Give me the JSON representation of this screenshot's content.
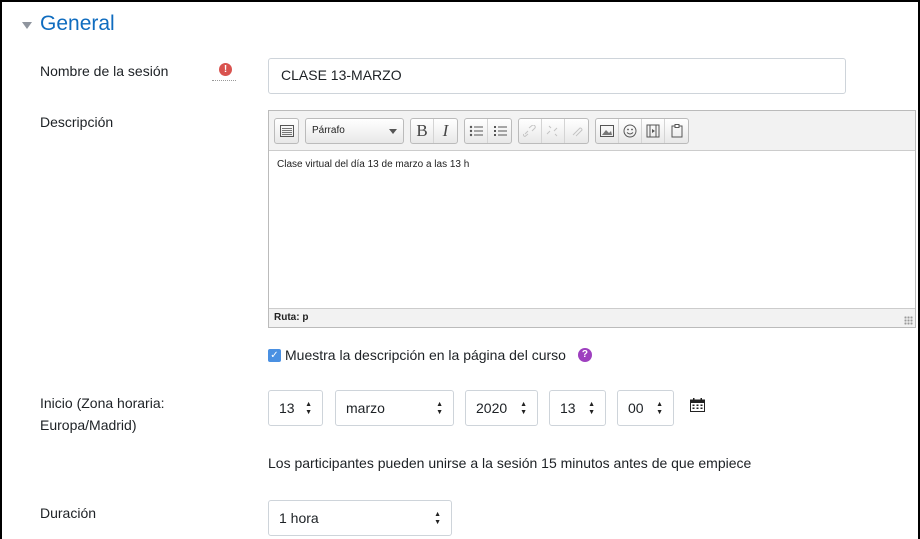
{
  "section": {
    "title": "General"
  },
  "name_field": {
    "label": "Nombre de la sesión",
    "required_icon": "exclamation-icon",
    "value": "CLASE 13-MARZO"
  },
  "description": {
    "label": "Descripción",
    "toolbar": {
      "format_select": "Párrafo",
      "buttons": [
        "expand-toolbar-icon",
        "bold-icon",
        "italic-icon",
        "bullet-list-icon",
        "numbered-list-icon",
        "link-icon",
        "unlink-icon",
        "anchor-icon",
        "image-icon",
        "emoticon-icon",
        "media-icon",
        "paste-icon"
      ],
      "bold_glyph": "B",
      "italic_glyph": "I"
    },
    "content": "Clase virtual del día 13 de marzo a las 13 h",
    "path": "Ruta: p"
  },
  "show_description": {
    "label": "Muestra la descripción en la página del curso",
    "checked": true,
    "help_icon": "question-icon"
  },
  "start": {
    "label_line1": "Inicio (Zona horaria:",
    "label_line2": "Europa/Madrid)",
    "day": "13",
    "month": "marzo",
    "year": "2020",
    "hour": "13",
    "minute": "00",
    "calendar_icon": "calendar-icon"
  },
  "join_note": "Los participantes pueden unirse a la sesión 15 minutos antes de que empiece",
  "duration": {
    "label": "Duración",
    "value": "1 hora"
  },
  "colors": {
    "accent": "#0f6cbf",
    "required": "#d9534f",
    "help": "#9e3fbf",
    "checkbox": "#4a90e2"
  }
}
